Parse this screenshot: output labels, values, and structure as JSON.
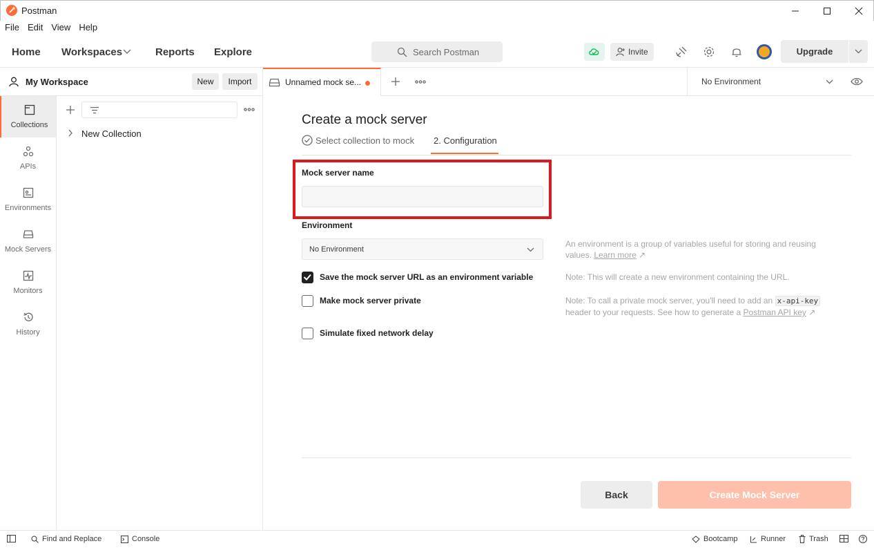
{
  "window": {
    "title": "Postman"
  },
  "menu": [
    "File",
    "Edit",
    "View",
    "Help"
  ],
  "header": {
    "nav": {
      "home": "Home",
      "workspaces": "Workspaces",
      "reports": "Reports",
      "explore": "Explore"
    },
    "search_placeholder": "Search Postman",
    "invite_label": "Invite",
    "upgrade_label": "Upgrade"
  },
  "workspace": {
    "name": "My Workspace",
    "new_label": "New",
    "import_label": "Import"
  },
  "rail": [
    {
      "label": "Collections",
      "icon": "collections-icon"
    },
    {
      "label": "APIs",
      "icon": "apis-icon"
    },
    {
      "label": "Environments",
      "icon": "environments-icon"
    },
    {
      "label": "Mock Servers",
      "icon": "mock-servers-icon"
    },
    {
      "label": "Monitors",
      "icon": "monitors-icon"
    },
    {
      "label": "History",
      "icon": "history-icon"
    }
  ],
  "collections": [
    {
      "label": "New Collection"
    }
  ],
  "tabs": {
    "active_label": "Unnamed mock se...",
    "environment": "No Environment"
  },
  "main": {
    "title": "Create a mock server",
    "step1": "Select collection to mock",
    "step2": "2. Configuration",
    "name_label": "Mock server name",
    "name_value": "",
    "environment_label": "Environment",
    "environment_value": "No Environment",
    "env_hint_1": "An environment is a group of variables useful for storing and reusing",
    "env_hint_2": "values.",
    "learn_more": "Learn more",
    "checkboxes": [
      {
        "label": "Save the mock server URL as an environment variable",
        "checked": true,
        "hint": "Note: This will create a new environment containing the URL."
      },
      {
        "label": "Make mock server private",
        "checked": false
      },
      {
        "label": "Simulate fixed network delay",
        "checked": false
      }
    ],
    "private_hint_1": "Note: To call a private mock server, you'll need to add an",
    "private_hint_code": "x-api-key",
    "private_hint_2": "header to your requests. See how to generate a",
    "private_hint_link": "Postman API key",
    "back_label": "Back",
    "create_label": "Create Mock Server"
  },
  "statusbar": {
    "find_replace": "Find and Replace",
    "console": "Console",
    "bootcamp": "Bootcamp",
    "runner": "Runner",
    "trash": "Trash"
  },
  "colors": {
    "accent": "#ff6c37",
    "highlight": "#e0181e",
    "create_disabled": "#ffc0ab"
  }
}
